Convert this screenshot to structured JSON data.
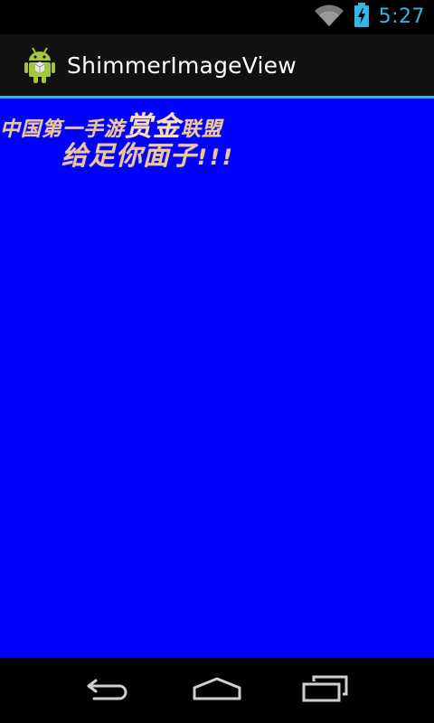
{
  "status_bar": {
    "time": "5:27",
    "icons": [
      "wifi-icon",
      "battery-charging-icon"
    ],
    "accent_color": "#33b5e5"
  },
  "action_bar": {
    "title": "ShimmerImageView",
    "app_icon": "android-robot-icon"
  },
  "content": {
    "background_color": "#0000ff",
    "text_color": "#eec792",
    "line1": {
      "part_a": "中国第一手游",
      "part_b": "赏金",
      "part_c": "联盟"
    },
    "line2": {
      "part_a": "给足你面子",
      "part_b": "!!!"
    }
  },
  "nav_bar": {
    "buttons": [
      "back-icon",
      "home-icon",
      "recent-apps-icon"
    ]
  }
}
